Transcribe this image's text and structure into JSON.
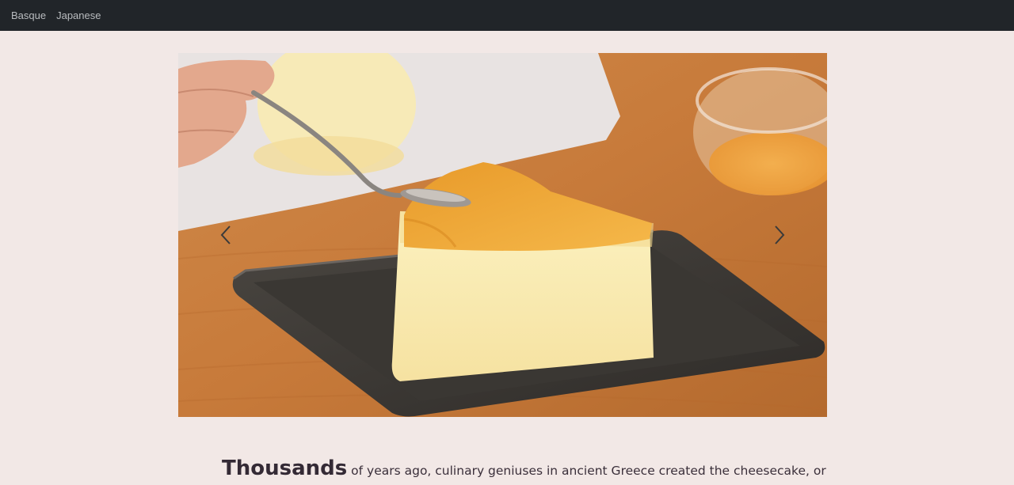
{
  "nav": {
    "items": [
      {
        "label": "Basque"
      },
      {
        "label": "Japanese"
      }
    ]
  },
  "carousel": {
    "image_subject": "slice of Japanese cheesecake with apricot glaze on a dark square plate, spoon above",
    "prev_icon": "chevron-left-icon",
    "next_icon": "chevron-right-icon"
  },
  "intro": {
    "lead": "Thousands",
    "text": " of years ago, culinary geniuses in ancient Greece created the cheesecake, or"
  },
  "colors": {
    "navbar": "#212529",
    "nav_text": "#b9bcbf",
    "page_bg": "#f2e8e6",
    "text": "#3a2f3a"
  }
}
